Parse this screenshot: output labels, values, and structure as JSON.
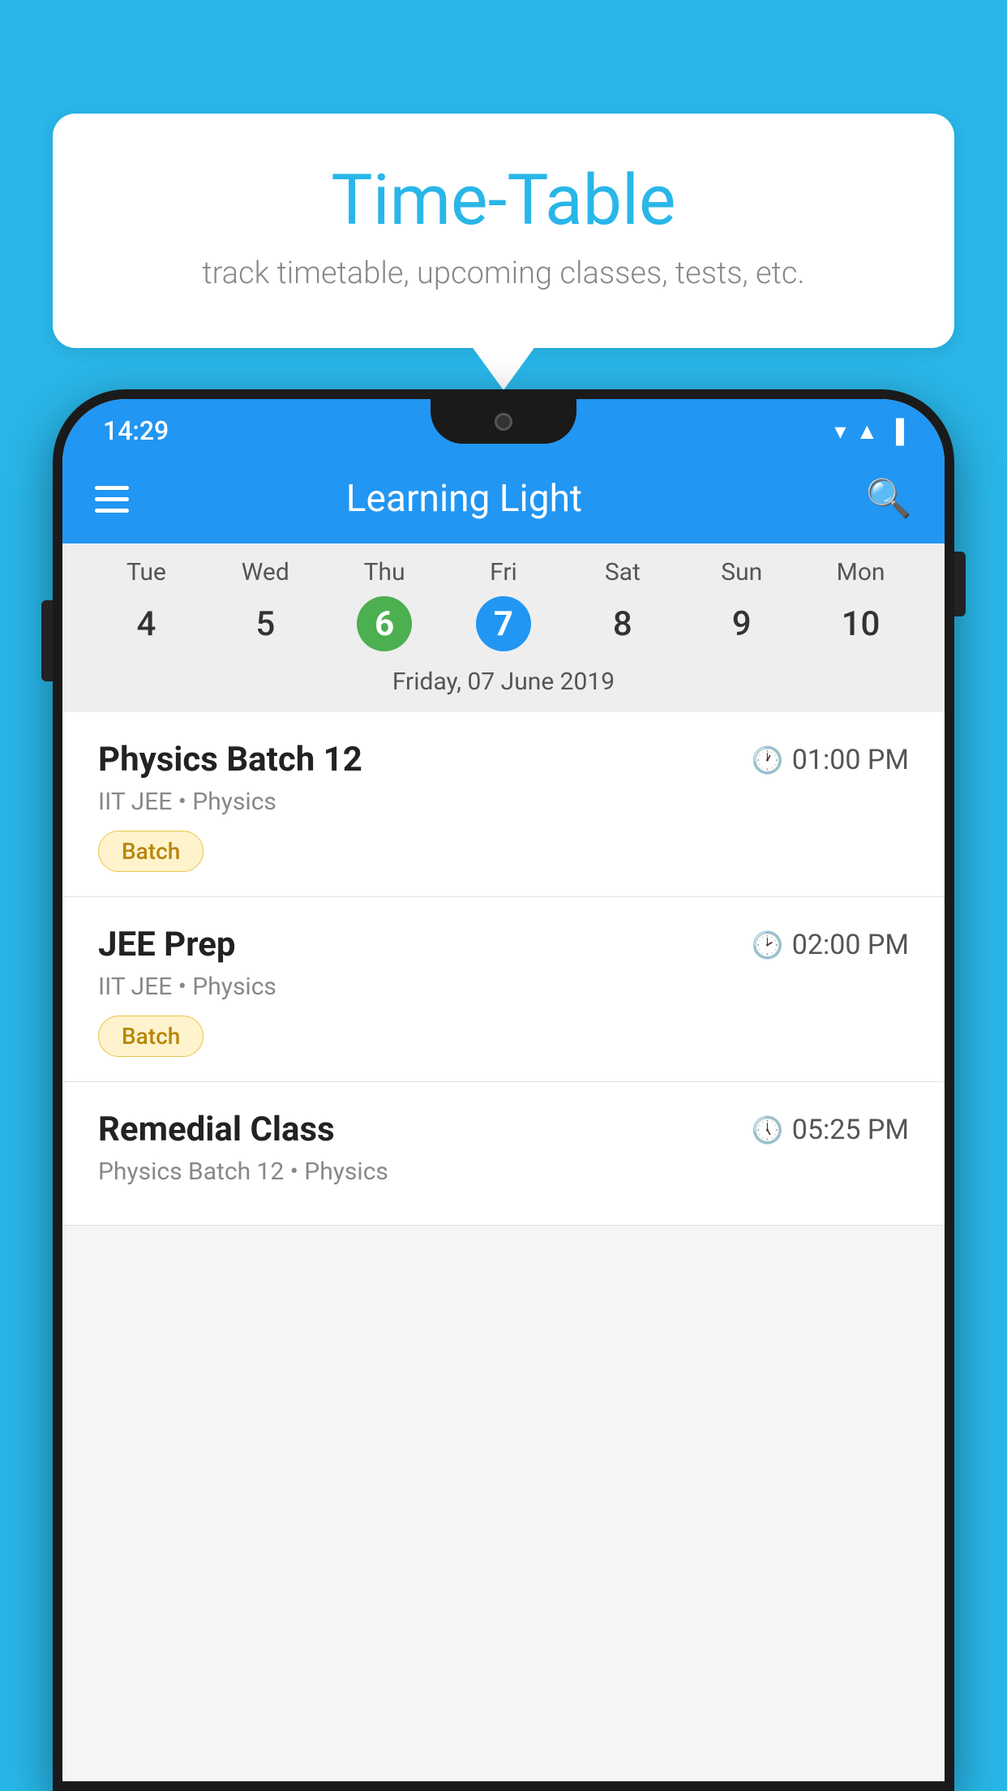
{
  "background_color": "#29B6E8",
  "bubble": {
    "title": "Time-Table",
    "subtitle": "track timetable, upcoming classes, tests, etc."
  },
  "phone": {
    "status_bar": {
      "time": "14:29"
    },
    "app_bar": {
      "title": "Learning Light"
    },
    "calendar": {
      "days": [
        {
          "label": "Tue",
          "num": "4",
          "state": "normal"
        },
        {
          "label": "Wed",
          "num": "5",
          "state": "normal"
        },
        {
          "label": "Thu",
          "num": "6",
          "state": "today"
        },
        {
          "label": "Fri",
          "num": "7",
          "state": "selected"
        },
        {
          "label": "Sat",
          "num": "8",
          "state": "normal"
        },
        {
          "label": "Sun",
          "num": "9",
          "state": "normal"
        },
        {
          "label": "Mon",
          "num": "10",
          "state": "normal"
        }
      ],
      "selected_date_label": "Friday, 07 June 2019"
    },
    "schedule": [
      {
        "title": "Physics Batch 12",
        "time": "01:00 PM",
        "subtitle": "IIT JEE • Physics",
        "tag": "Batch"
      },
      {
        "title": "JEE Prep",
        "time": "02:00 PM",
        "subtitle": "IIT JEE • Physics",
        "tag": "Batch"
      },
      {
        "title": "Remedial Class",
        "time": "05:25 PM",
        "subtitle": "Physics Batch 12 • Physics",
        "tag": null
      }
    ]
  }
}
